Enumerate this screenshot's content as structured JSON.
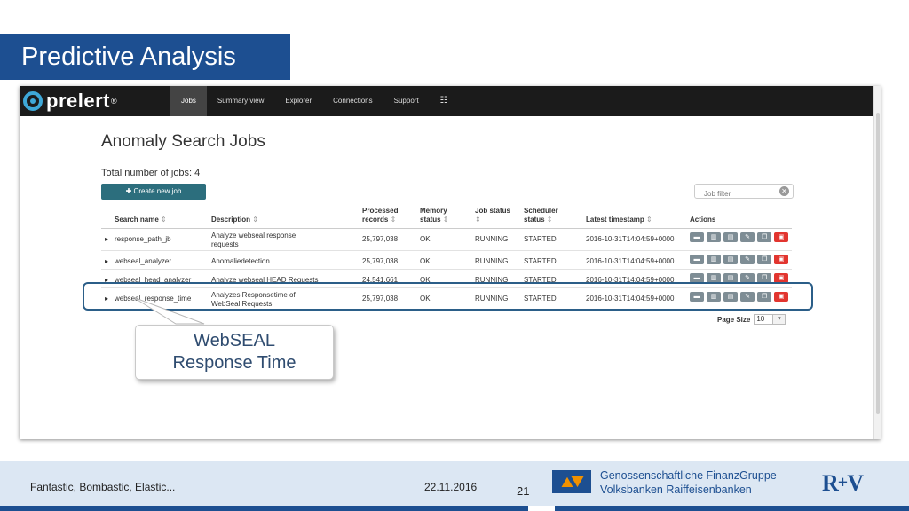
{
  "slide": {
    "title": "Predictive Analysis",
    "footer_text": "Fantastic, Bombastic, Elastic...",
    "date": "22.11.2016",
    "page_number": "21",
    "partner_text_line1": "Genossenschaftliche FinanzGruppe",
    "partner_text_line2": "Volksbanken Raiffeisenbanken",
    "rv_logo_left": "R",
    "rv_logo_plus": "+",
    "rv_logo_right": "V",
    "brand_color": "#1d4f91"
  },
  "app": {
    "logo_text": "prelert",
    "logo_reg": "®",
    "nav": [
      "Jobs",
      "Summary view",
      "Explorer",
      "Connections",
      "Support",
      "☷"
    ],
    "active_nav": "Jobs",
    "page_heading": "Anomaly Search Jobs",
    "total_jobs_label": "Total number of jobs: 4",
    "create_button": "✚ Create new job",
    "filter_placeholder": "Job filter",
    "filter_clear": "✕",
    "sort_icon": "⇕",
    "expand_icon": "▸",
    "columns": {
      "name": "Search name",
      "desc": "Description",
      "records_line1": "Processed",
      "records_line2": "records",
      "memory_line1": "Memory",
      "memory_line2": "status",
      "job_status": "Job status",
      "scheduler_line1": "Scheduler",
      "scheduler_line2": "status",
      "timestamp": "Latest timestamp",
      "actions": "Actions"
    },
    "action_icons": {
      "a1": "▬",
      "a2": "▥",
      "a3": "▤",
      "a4": "✎",
      "a5": "❐",
      "a6": "▣"
    },
    "jobs": [
      {
        "name": "response_path_jb",
        "desc_line1": "Analyze webseal response",
        "desc_line2": "requests",
        "records": "25,797,038",
        "memory": "OK",
        "job_status": "RUNNING",
        "scheduler": "STARTED",
        "timestamp": "2016-10-31T14:04:59+0000"
      },
      {
        "name": "webseal_analyzer",
        "desc_line1": "Anomaliedetection",
        "desc_line2": "",
        "records": "25,797,038",
        "memory": "OK",
        "job_status": "RUNNING",
        "scheduler": "STARTED",
        "timestamp": "2016-10-31T14:04:59+0000"
      },
      {
        "name": "webseal_head_analyzer",
        "desc_line1": "Analyze webseal HEAD Requests",
        "desc_line2": "",
        "records": "24,541,661",
        "memory": "OK",
        "job_status": "RUNNING",
        "scheduler": "STARTED",
        "timestamp": "2016-10-31T14:04:59+0000"
      },
      {
        "name": "webseal_response_time",
        "desc_line1": "Analyzes Responsetime of",
        "desc_line2": "WebSeal Requests",
        "records": "25,797,038",
        "memory": "OK",
        "job_status": "RUNNING",
        "scheduler": "STARTED",
        "timestamp": "2016-10-31T14:04:59+0000"
      }
    ],
    "page_size_label": "Page Size",
    "page_size_value": "10",
    "page_size_arrow": "▾"
  },
  "callout": {
    "line1": "WebSEAL",
    "line2": "Response Time"
  }
}
